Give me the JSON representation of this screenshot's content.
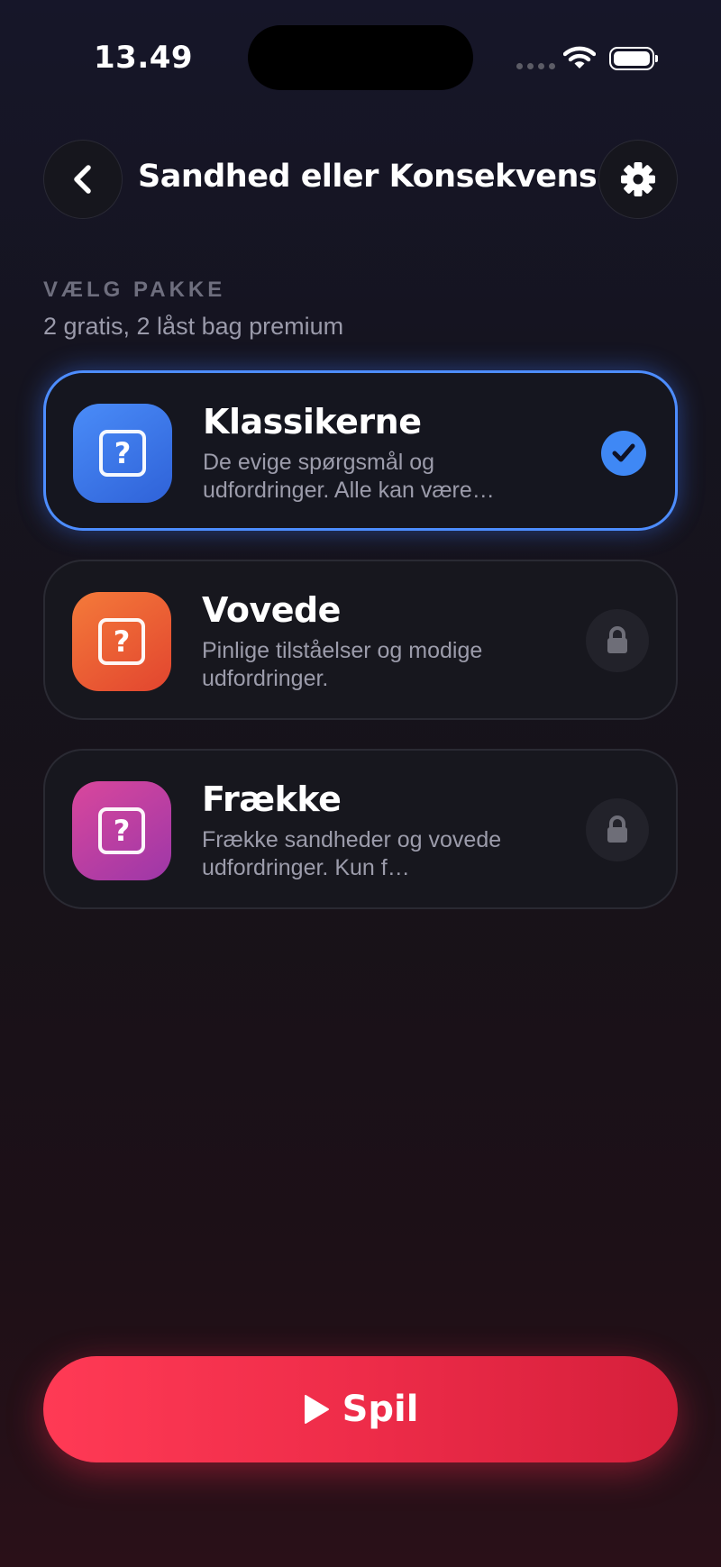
{
  "status_bar": {
    "time": "13.49"
  },
  "header": {
    "title": "Sandhed eller Konsekvens"
  },
  "section": {
    "label": "VÆLG PAKKE",
    "subtitle": "2 gratis, 2 låst bag premium"
  },
  "packs": [
    {
      "title": "Klassikerne",
      "description": "De evige spørgsmål og udfordringer. Alle kan være…",
      "state": "selected",
      "color": "#3f7df0"
    },
    {
      "title": "Vovede",
      "description": "Pinlige tilståelser og modige udfordringer.",
      "state": "locked",
      "color": "#f05a35"
    },
    {
      "title": "Frække",
      "description": "Frække sandheder og vovede udfordringer. Kun f…",
      "state": "locked",
      "color": "#c23f9e"
    }
  ],
  "play_button": {
    "label": "Spil"
  },
  "colors": {
    "accent": "#4d8dff",
    "play": "#ee2c49"
  }
}
